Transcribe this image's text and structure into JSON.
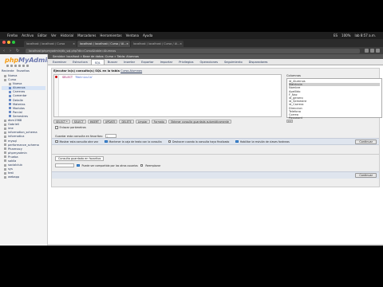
{
  "mac_menu": {
    "apple": "",
    "items": [
      "Firefox",
      "Archivo",
      "Editar",
      "Ver",
      "Historial",
      "Marcadores",
      "Herramientas",
      "Ventana",
      "Ayuda"
    ],
    "status": [
      "ES",
      "100%",
      "lab 8:57 a.m."
    ]
  },
  "browser": {
    "tabs": [
      {
        "label": "localhost / localhost / Curso",
        "active": false
      },
      {
        "label": "localhost / localhost / Curso / Al...",
        "active": true
      },
      {
        "label": "localhost / localhost / Curso / Al...",
        "active": false
      }
    ],
    "url": "localhost/phpmyadmin/db_sql.php?db=Curso&table=Alumnos"
  },
  "pma": {
    "logo_a": "php",
    "logo_b": "MyAdmin",
    "sidebar_tabs": [
      "Reciente",
      "Favoritas"
    ],
    "tree": [
      {
        "label": "Nueva",
        "indent": 0,
        "kind": "db"
      },
      {
        "label": "Curso",
        "indent": 0,
        "kind": "db"
      },
      {
        "label": "Nueva",
        "indent": 1,
        "kind": "db"
      },
      {
        "label": "Alumnos",
        "indent": 1,
        "kind": "tbl",
        "selected": true
      },
      {
        "label": "Carreras",
        "indent": 1,
        "kind": "tbl"
      },
      {
        "label": "Comentar",
        "indent": 1,
        "kind": "tbl"
      },
      {
        "label": "Detalle",
        "indent": 1,
        "kind": "tbl"
      },
      {
        "label": "Materias",
        "indent": 1,
        "kind": "tbl"
      },
      {
        "label": "Modulos",
        "indent": 1,
        "kind": "tbl"
      },
      {
        "label": "Parcial",
        "indent": 1,
        "kind": "tbl"
      },
      {
        "label": "Semestres",
        "indent": 1,
        "kind": "tbl"
      },
      {
        "label": "dbm1968",
        "indent": 0,
        "kind": "db"
      },
      {
        "label": "Gabrieli",
        "indent": 0,
        "kind": "db"
      },
      {
        "label": "ime",
        "indent": 0,
        "kind": "db"
      },
      {
        "label": "information_schema",
        "indent": 0,
        "kind": "db"
      },
      {
        "label": "informatica",
        "indent": 0,
        "kind": "db"
      },
      {
        "label": "mysql",
        "indent": 0,
        "kind": "db"
      },
      {
        "label": "performance_schema",
        "indent": 0,
        "kind": "db"
      },
      {
        "label": "Pharmacy",
        "indent": 0,
        "kind": "db"
      },
      {
        "label": "phpmyadmin",
        "indent": 0,
        "kind": "db"
      },
      {
        "label": "Prueba",
        "indent": 0,
        "kind": "db"
      },
      {
        "label": "sakila",
        "indent": 0,
        "kind": "db"
      },
      {
        "label": "socialclub",
        "indent": 0,
        "kind": "db"
      },
      {
        "label": "sys",
        "indent": 0,
        "kind": "db"
      },
      {
        "label": "test",
        "indent": 0,
        "kind": "db"
      },
      {
        "label": "webapp",
        "indent": 0,
        "kind": "db"
      }
    ],
    "breadcrumb": "Servidor: localhost » Base de datos: Curso » Tabla: Alumnos",
    "menu_tabs": [
      {
        "label": "Examinar",
        "active": false
      },
      {
        "label": "Estructura",
        "active": false
      },
      {
        "label": "SQL",
        "active": true
      },
      {
        "label": "Buscar",
        "active": false
      },
      {
        "label": "Insertar",
        "active": false
      },
      {
        "label": "Exportar",
        "active": false
      },
      {
        "label": "Importar",
        "active": false
      },
      {
        "label": "Privilegios",
        "active": false
      },
      {
        "label": "Operaciones",
        "active": false
      },
      {
        "label": "Seguimiento",
        "active": false
      },
      {
        "label": "Disparadores",
        "active": false
      }
    ],
    "sql": {
      "title_prefix": "Ejecutar la(s) consulta(s) SQL en la tabla",
      "title_link": "Curso.Alumnos",
      "code_kw": "SELECT",
      "code_rest": " 'Matricula'",
      "columns_label": "Columnas",
      "columns": [
        "id_Alumnos",
        "Matricula",
        "Nombre",
        "Apellido",
        "F_Nac",
        "id_genero",
        "id_Semestre",
        "id_Carrera",
        "Direccion",
        "Telefono",
        "Correo",
        "Password"
      ],
      "selected_column": "Matricula",
      "insert_label": "<<",
      "query_buttons": [
        "SELECT *",
        "SELECT",
        "INSERT",
        "UPDATE",
        "DELETE",
        "Limpiar",
        "Formato",
        "Obtener consulta guardada automáticamente"
      ],
      "bind_params": "Enlazar parámetros",
      "delimiter_label": "Guardar esta consulta en favoritos:",
      "delimiter_value": ";",
      "options": [
        "Mostrar esta consulta otra vez",
        "Mantener la caja de texto con la consulta",
        "Deshacer cuando la consulta haya finalizado",
        "Habilitar la revisión de claves foráneas"
      ],
      "go": "Continuar"
    },
    "bookmark": {
      "tab": "Consulta guardada en favoritos",
      "shared_label": "Puede ser compartida por los otros usuarios",
      "replace_label": "Reemplazar",
      "go": "Continuar"
    }
  }
}
